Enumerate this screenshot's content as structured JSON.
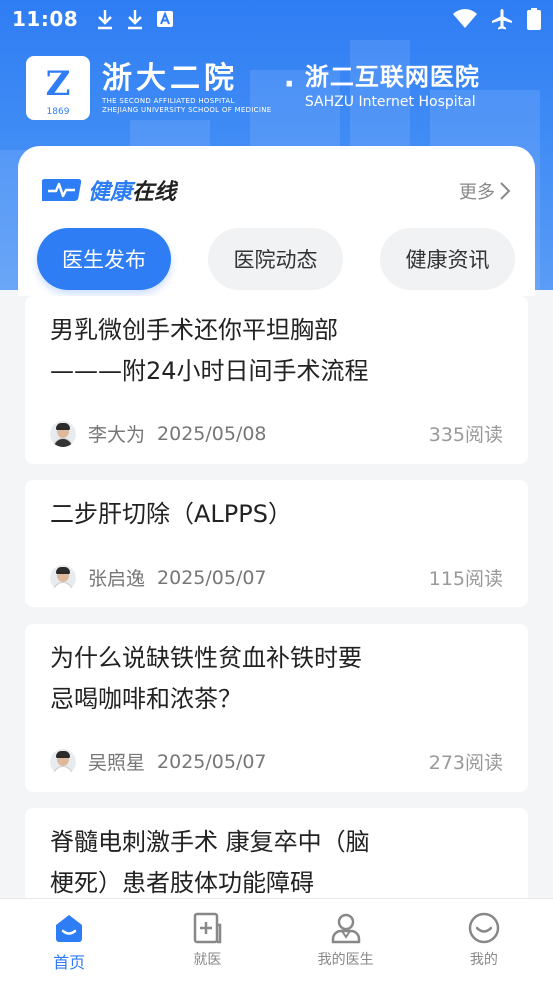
{
  "status_bar": {
    "time": "11:08"
  },
  "header": {
    "logo_mark": "Z",
    "logo_year": "1869",
    "hospital_name_cn": "浙大二院",
    "hospital_name_en_1": "THE SECOND AFFILIATED HOSPITAL",
    "hospital_name_en_2": "ZHEJIANG UNIVERSITY SCHOOL OF MEDICINE",
    "separator": "·",
    "internet_hospital_cn": "浙二互联网医院",
    "internet_hospital_en": "SAHZU Internet Hospital"
  },
  "news_card": {
    "title_part1": "健康",
    "title_part2": "在线",
    "more_label": "更多",
    "tabs": [
      {
        "label": "医生发布",
        "active": true
      },
      {
        "label": "医院动态",
        "active": false
      },
      {
        "label": "健康资讯",
        "active": false
      }
    ]
  },
  "articles": [
    {
      "title_line1": "男乳微创手术还你平坦胸部",
      "title_line2": "———附24小时日间手术流程",
      "author": "李大为",
      "date": "2025/05/08",
      "reads": "335阅读"
    },
    {
      "title_line1": "二步肝切除（ALPPS）",
      "title_line2": "",
      "author": "张启逸",
      "date": "2025/05/07",
      "reads": "115阅读"
    },
    {
      "title_line1": "为什么说缺铁性贫血补铁时要",
      "title_line2": "忌喝咖啡和浓茶？",
      "author": "吴照星",
      "date": "2025/05/07",
      "reads": "273阅读"
    },
    {
      "title_line1": "脊髓电刺激手术 康复卒中（脑",
      "title_line2": "梗死）患者肢体功能障碍",
      "author": "",
      "date": "",
      "reads": ""
    }
  ],
  "bottom_nav": [
    {
      "label": "首页",
      "icon": "home-icon",
      "active": true
    },
    {
      "label": "就医",
      "icon": "medical-icon",
      "active": false
    },
    {
      "label": "我的医生",
      "icon": "doctor-icon",
      "active": false
    },
    {
      "label": "我的",
      "icon": "profile-icon",
      "active": false
    }
  ],
  "colors": {
    "accent": "#2f7df4",
    "text": "#222222",
    "muted": "#777777"
  }
}
